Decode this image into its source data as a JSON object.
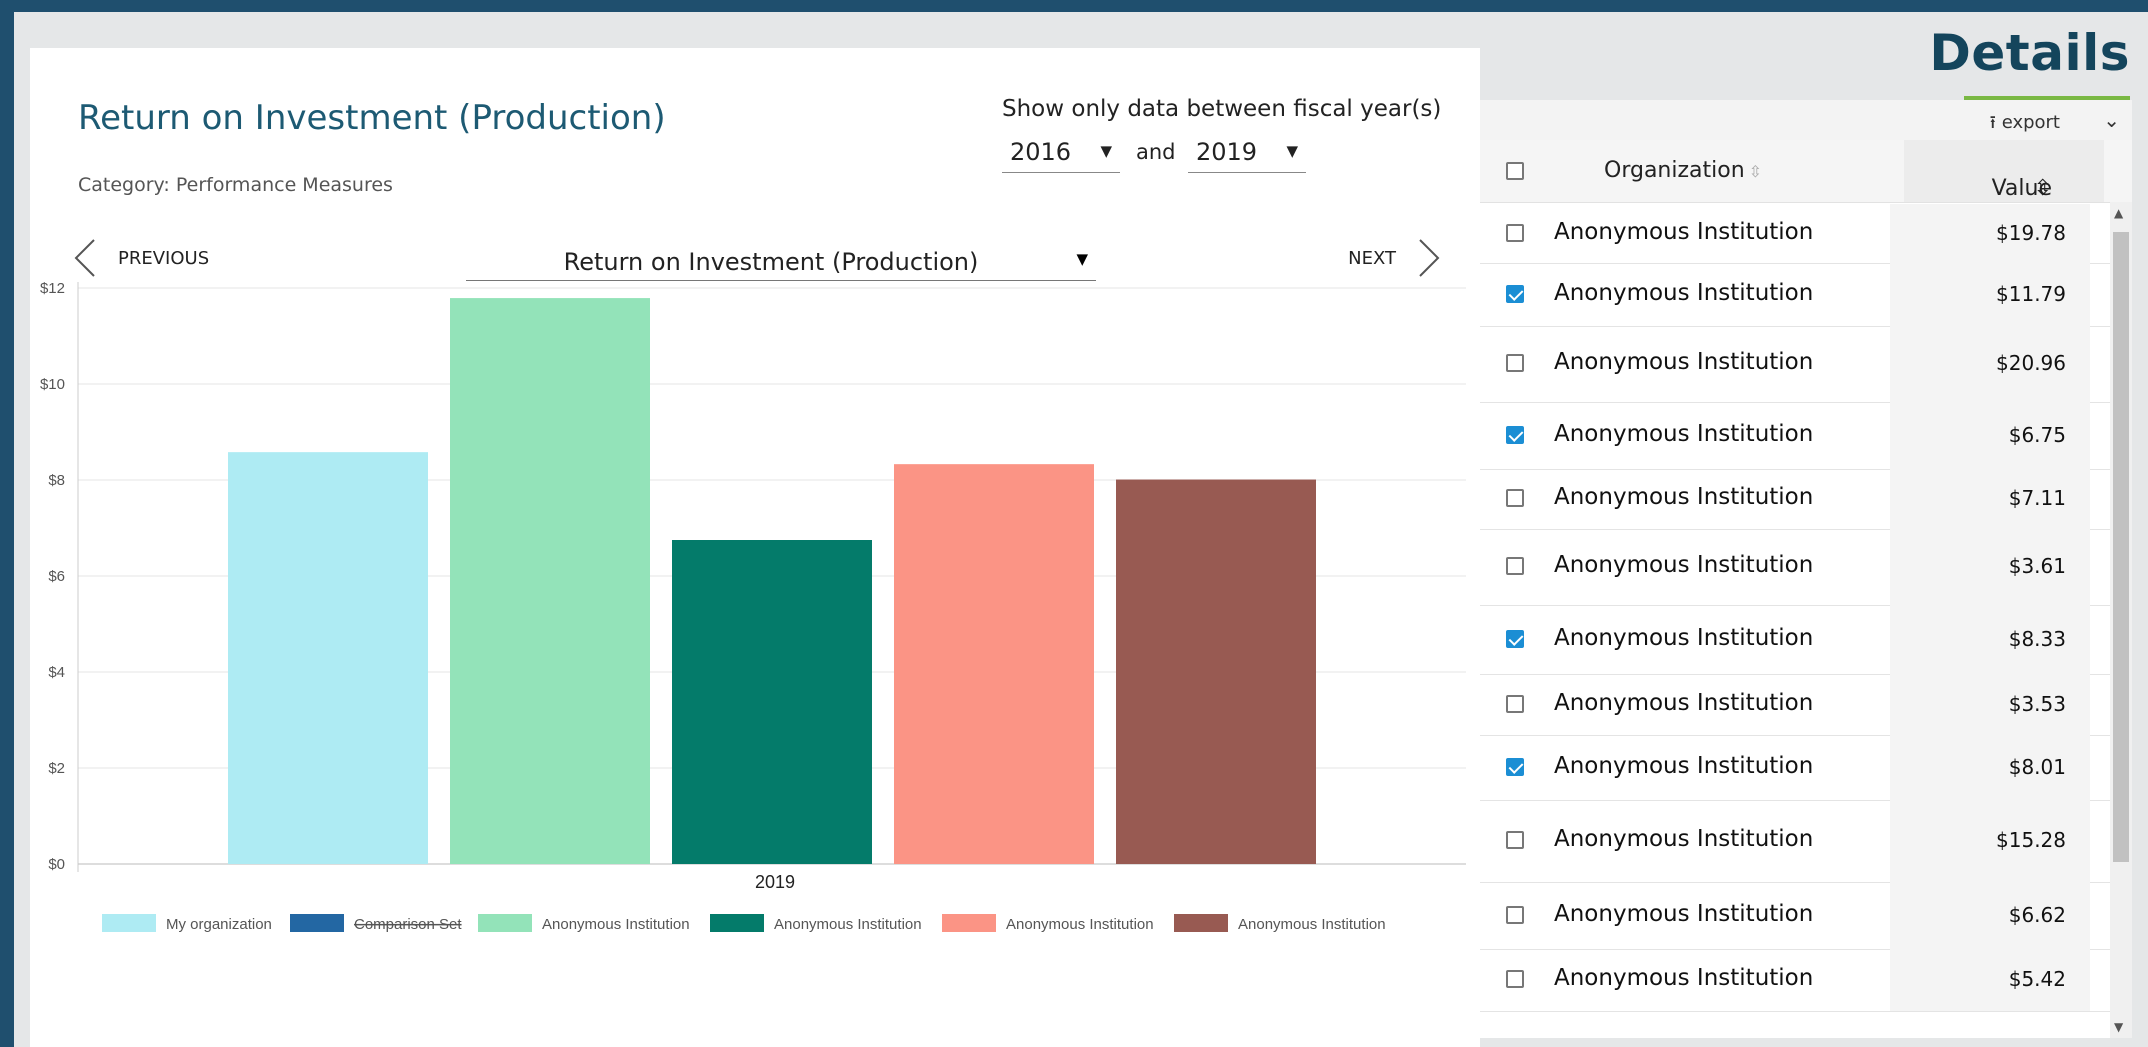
{
  "header": {
    "title": "Details"
  },
  "chart_panel": {
    "title": "Return on Investment (Production)",
    "category_label": "Category:",
    "category_value": "Performance Measures",
    "fy_filter": {
      "label": "Show only data between fiscal year(s)",
      "from": "2016",
      "and": "and",
      "to": "2019"
    },
    "nav": {
      "previous": "PREVIOUS",
      "next": "NEXT",
      "measure": "Return on Investment (Production)"
    }
  },
  "chart_data": {
    "type": "bar",
    "categories": [
      "2019"
    ],
    "yticks": [
      "$0",
      "$2",
      "$4",
      "$6",
      "$8",
      "$10",
      "$12"
    ],
    "ylim": [
      0,
      12
    ],
    "grid": true,
    "legend_position": "bottom",
    "series": [
      {
        "name": "My organization",
        "values": [
          8.58
        ],
        "color": "#aeebf3",
        "hidden": false
      },
      {
        "name": "Comparison Set",
        "values": [
          null
        ],
        "color": "#2367a3",
        "hidden": true
      },
      {
        "name": "Anonymous Institution",
        "values": [
          11.79
        ],
        "color": "#93e3b9",
        "hidden": false
      },
      {
        "name": "Anonymous Institution",
        "values": [
          6.75
        ],
        "color": "#047b6a",
        "hidden": false
      },
      {
        "name": "Anonymous Institution",
        "values": [
          8.33
        ],
        "color": "#fb9485",
        "hidden": false
      },
      {
        "name": "Anonymous Institution",
        "values": [
          8.01
        ],
        "color": "#985a52",
        "hidden": false
      }
    ]
  },
  "table": {
    "export_label": "export",
    "columns": {
      "organization": "Organization",
      "value": "Value"
    },
    "rows": [
      {
        "org": "Anonymous Institution",
        "value": "$19.78",
        "checked": false
      },
      {
        "org": "Anonymous Institution",
        "value": "$11.79",
        "checked": true
      },
      {
        "org": "Anonymous Institution",
        "value": "$20.96",
        "checked": false
      },
      {
        "org": "Anonymous Institution",
        "value": "$6.75",
        "checked": true
      },
      {
        "org": "Anonymous Institution",
        "value": "$7.11",
        "checked": false
      },
      {
        "org": "Anonymous Institution",
        "value": "$3.61",
        "checked": false
      },
      {
        "org": "Anonymous Institution",
        "value": "$8.33",
        "checked": true
      },
      {
        "org": "Anonymous Institution",
        "value": "$3.53",
        "checked": false
      },
      {
        "org": "Anonymous Institution",
        "value": "$8.01",
        "checked": true
      },
      {
        "org": "Anonymous Institution",
        "value": "$15.28",
        "checked": false
      },
      {
        "org": "Anonymous Institution",
        "value": "$6.62",
        "checked": false
      },
      {
        "org": "Anonymous Institution",
        "value": "$5.42",
        "checked": false
      }
    ]
  }
}
